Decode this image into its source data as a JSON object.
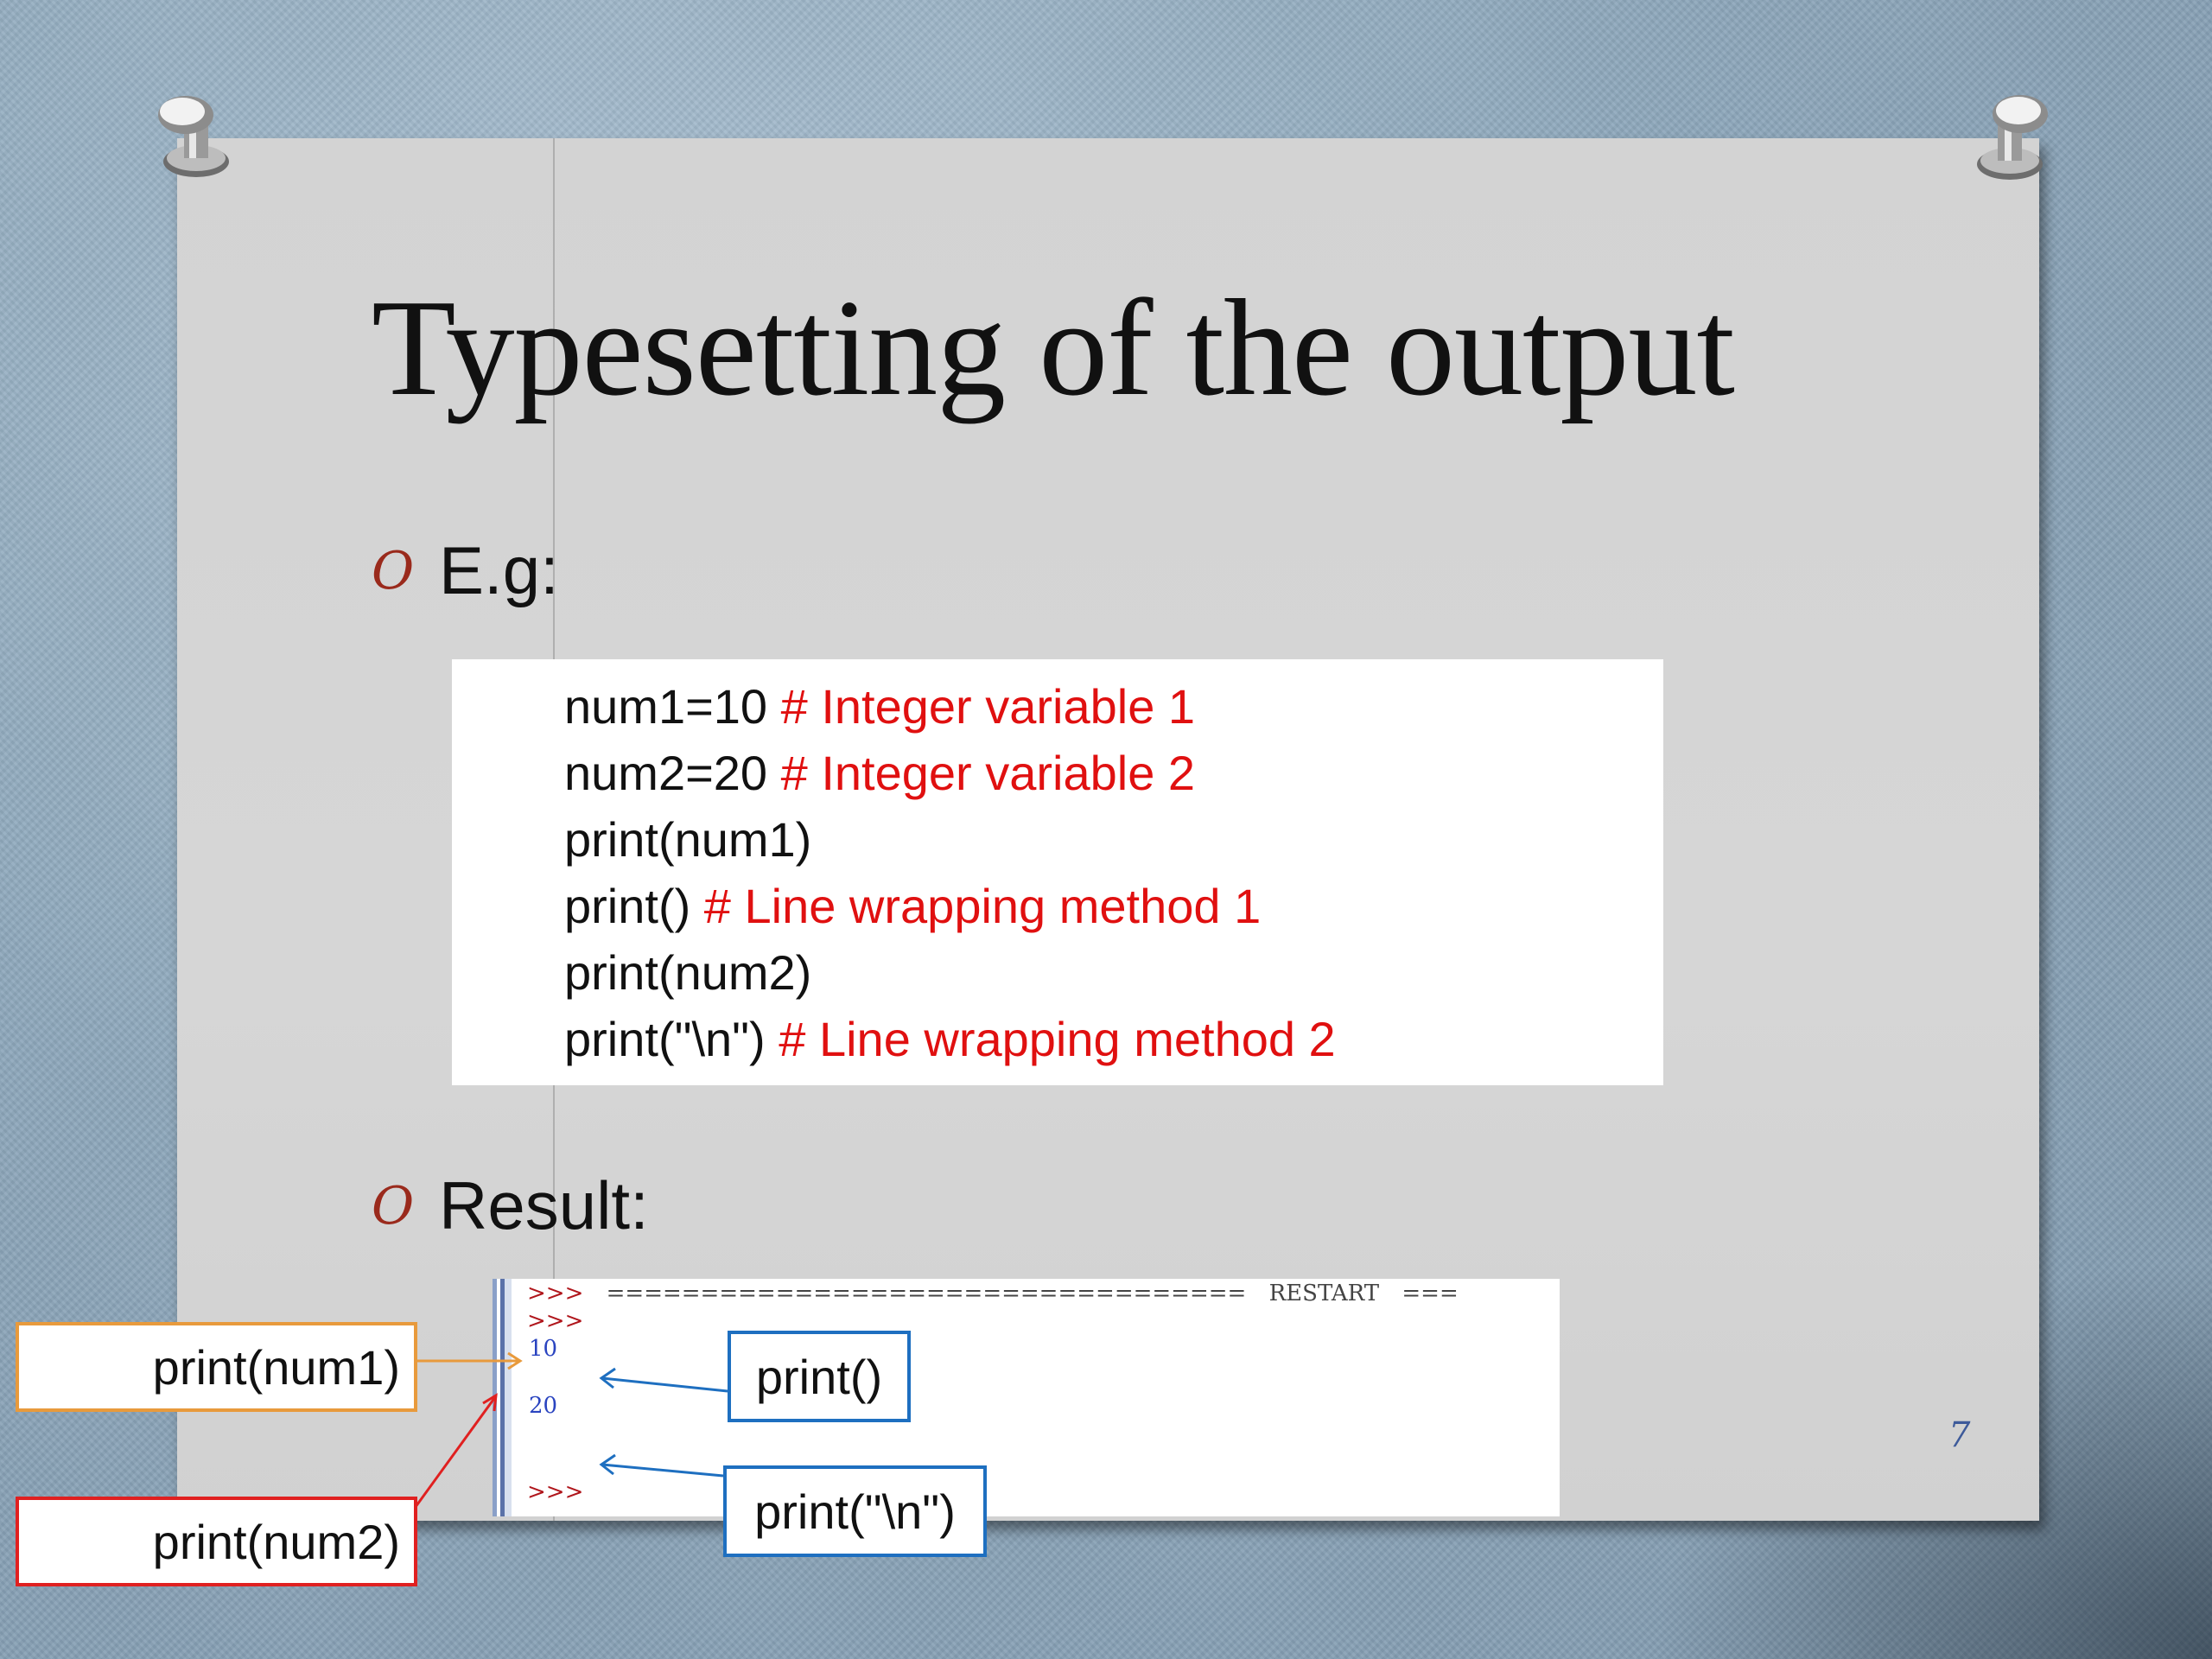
{
  "slide": {
    "title": "Typesetting of the output",
    "page_number": "7",
    "bullets": [
      {
        "glyph": "O",
        "label": "E.g:"
      },
      {
        "glyph": "O",
        "label": "Result:"
      }
    ],
    "code": [
      {
        "code": "num1=10 ",
        "comment": "# Integer variable 1"
      },
      {
        "code": "num2=20 ",
        "comment": "# Integer variable 2"
      },
      {
        "code": "print(num1)",
        "comment": ""
      },
      {
        "code": "print() ",
        "comment": "# Line wrapping method 1"
      },
      {
        "code": "print(num2)",
        "comment": ""
      },
      {
        "code": "print(\"\\n\") ",
        "comment": "# Line wrapping method 2"
      }
    ],
    "shell": {
      "line1_prompt": ">>>",
      "line1_rule": "==================================",
      "line1_restart": "RESTART",
      "line1_tail": "===",
      "line2_prompt": ">>>",
      "out1": "10",
      "out2": "20",
      "last_prompt": ">>>"
    },
    "callouts": {
      "num1": "print(num1)",
      "num2": "print(num2)",
      "empty": "print()",
      "newline": "print(\"\\n\")"
    },
    "colors": {
      "comment": "#e01010",
      "bullet": "#9a2a1c",
      "callout_orange": "#e89a3c",
      "callout_red": "#e02020",
      "callout_blue": "#1e6fc0"
    }
  }
}
